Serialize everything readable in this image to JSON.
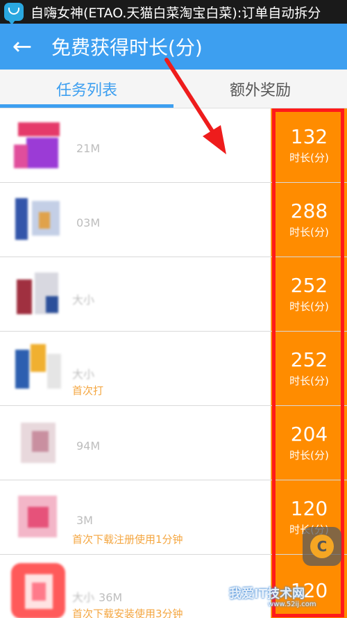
{
  "status_bar": {
    "text": "自嗨女神(ETAO.天猫白菜淘宝白菜):订单自动拆分"
  },
  "app_bar": {
    "back_icon": "arrow-left-icon",
    "title": "免费获得时长(分)"
  },
  "tabs": [
    {
      "label": "任务列表",
      "active": true
    },
    {
      "label": "额外奖励",
      "active": false
    }
  ],
  "tasks": [
    {
      "name": "",
      "size_label": "",
      "size": "21M",
      "hint": "",
      "reward": "132",
      "reward_unit": "时长(分)"
    },
    {
      "name": "",
      "size_label": "",
      "size": "03M",
      "hint": "",
      "reward": "288",
      "reward_unit": "时长(分)"
    },
    {
      "name": "",
      "size_label": "大小",
      "size": "",
      "hint": "",
      "reward": "252",
      "reward_unit": "时长(分)"
    },
    {
      "name": "",
      "size_label": "大小",
      "size": "",
      "hint": "首次打",
      "reward": "252",
      "reward_unit": "时长(分)"
    },
    {
      "name": "",
      "size_label": "",
      "size": "94M",
      "hint": "",
      "reward": "204",
      "reward_unit": "时长(分)"
    },
    {
      "name": "",
      "size_label": "",
      "size": "3M",
      "hint": "首次下载注册使用1分钟",
      "reward": "120",
      "reward_unit": "时长(分)"
    },
    {
      "name": "",
      "size_label": "大小",
      "size": "36M",
      "hint": "首次下载安装使用3分钟",
      "reward": "120",
      "reward_unit": ""
    }
  ],
  "float_button": {
    "icon": "c-logo-icon",
    "letter": "C"
  },
  "watermark": {
    "text": "我爱IT技术网",
    "url": "www.52ij.com"
  },
  "colors": {
    "status_bar": "#1a1a1a",
    "app_bar": "#3d9ff0",
    "reward_bg": "#ff8c00",
    "highlight": "#ff1a1a",
    "hint": "#f4a640"
  }
}
